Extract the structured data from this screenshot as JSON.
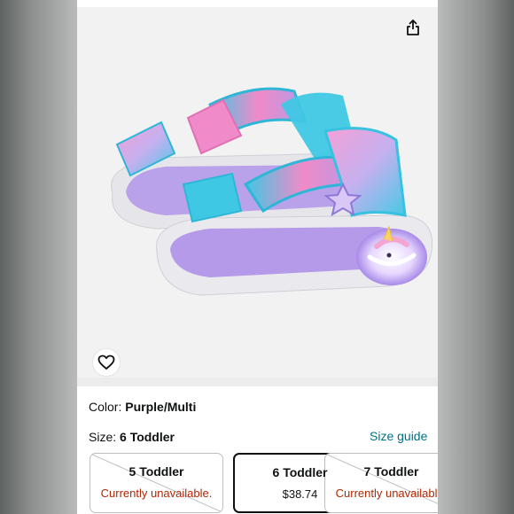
{
  "product": {
    "color_label": "Color:",
    "color_value": "Purple/Multi",
    "size_label": "Size:",
    "size_value": "6 Toddler",
    "size_guide_label": "Size guide"
  },
  "sizes": [
    {
      "name": "5 Toddler",
      "sub": "Currently unavailable.",
      "state": "unavailable"
    },
    {
      "name": "6 Toddler",
      "sub": "$38.74",
      "state": "selected"
    },
    {
      "name": "7 Toddler",
      "sub": "Currently unavailable.",
      "state": "unavailable"
    }
  ],
  "icons": {
    "share": "share-icon",
    "favorite": "heart-icon"
  },
  "colors": {
    "link": "#007185",
    "unavailable": "#b12704",
    "text": "#0f1111",
    "sandal_aqua": "#3fc8e4",
    "sandal_pink": "#f08ac8",
    "sandal_lavender": "#b49ae8"
  }
}
